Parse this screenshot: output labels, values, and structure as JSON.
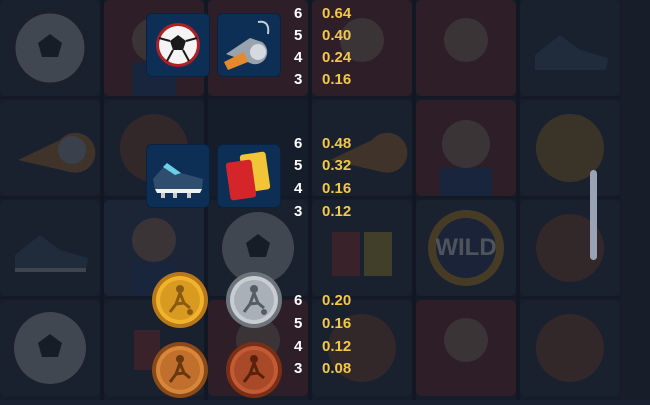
{
  "paytable": {
    "groups": [
      {
        "symbols": [
          {
            "icon": "soccer-ball-icon"
          },
          {
            "icon": "whistle-icon"
          }
        ],
        "rows": [
          {
            "count": "6",
            "value": "0.64"
          },
          {
            "count": "5",
            "value": "0.40"
          },
          {
            "count": "4",
            "value": "0.24"
          },
          {
            "count": "3",
            "value": "0.16"
          }
        ]
      },
      {
        "symbols": [
          {
            "icon": "football-boot-icon"
          },
          {
            "icon": "cards-icon"
          }
        ],
        "rows": [
          {
            "count": "6",
            "value": "0.48"
          },
          {
            "count": "5",
            "value": "0.32"
          },
          {
            "count": "4",
            "value": "0.16"
          },
          {
            "count": "3",
            "value": "0.12"
          }
        ]
      },
      {
        "symbols": [
          {
            "icon": "gold-coin-icon"
          },
          {
            "icon": "silver-coin-icon"
          },
          {
            "icon": "bronze-coin-icon"
          },
          {
            "icon": "copper-coin-icon"
          }
        ],
        "rows": [
          {
            "count": "6",
            "value": "0.20"
          },
          {
            "count": "5",
            "value": "0.16"
          },
          {
            "count": "4",
            "value": "0.12"
          },
          {
            "count": "3",
            "value": "0.08"
          }
        ]
      }
    ]
  },
  "background_reels": {
    "wild_label": "WILD"
  },
  "colors": {
    "payout_value": "#f2c84b",
    "payout_count": "#ffffff",
    "symbol_tile": "#0e2f55"
  }
}
